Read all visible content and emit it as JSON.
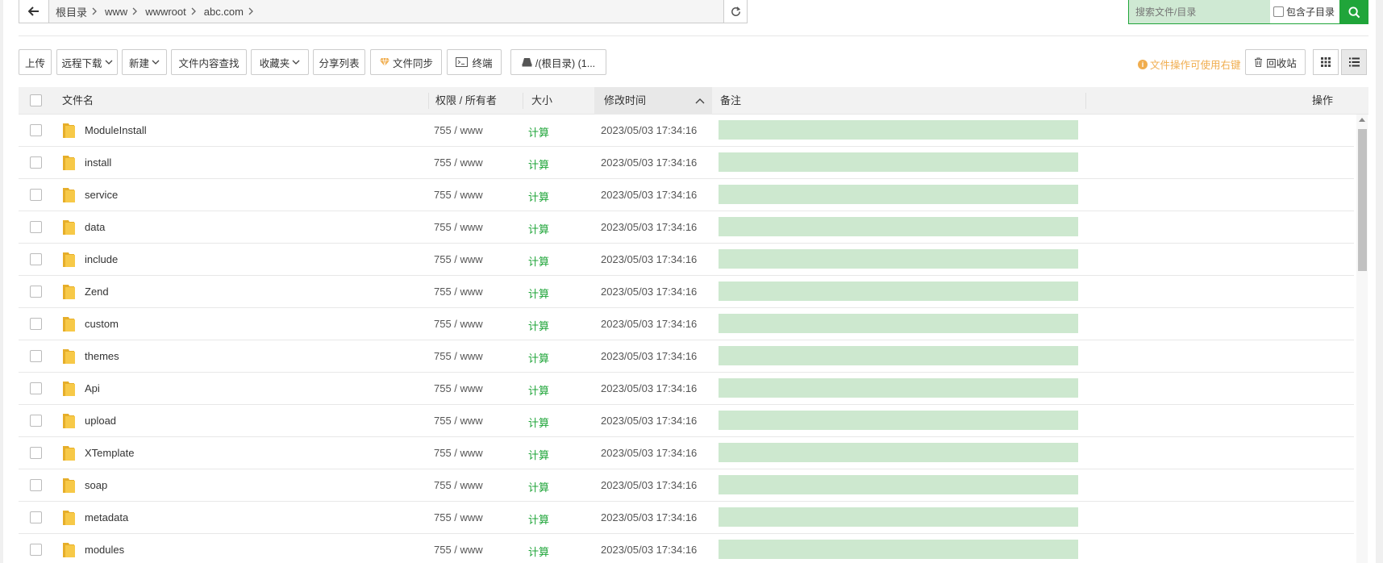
{
  "breadcrumb": [
    "根目录",
    "www",
    "wwwroot",
    "abc.com"
  ],
  "search": {
    "placeholder": "搜索文件/目录",
    "include_sub_label": "包含子目录"
  },
  "toolbar": {
    "upload": "上传",
    "remote_download": "远程下载",
    "new": "新建",
    "content_search": "文件内容查找",
    "favorites": "收藏夹",
    "share_list": "分享列表",
    "file_sync": "文件同步",
    "terminal": "终端",
    "disk": "/(根目录) (1...",
    "tip": "文件操作可使用右键",
    "recycle": "回收站"
  },
  "table": {
    "headers": {
      "name": "文件名",
      "perm": "权限 / 所有者",
      "size": "大小",
      "mtime": "修改时间",
      "note": "备注",
      "ops": "操作"
    },
    "rows": [
      {
        "name": "ModuleInstall",
        "perm": "755 / www",
        "size": "计算",
        "mtime": "2023/05/03 17:34:16"
      },
      {
        "name": "install",
        "perm": "755 / www",
        "size": "计算",
        "mtime": "2023/05/03 17:34:16"
      },
      {
        "name": "service",
        "perm": "755 / www",
        "size": "计算",
        "mtime": "2023/05/03 17:34:16"
      },
      {
        "name": "data",
        "perm": "755 / www",
        "size": "计算",
        "mtime": "2023/05/03 17:34:16"
      },
      {
        "name": "include",
        "perm": "755 / www",
        "size": "计算",
        "mtime": "2023/05/03 17:34:16"
      },
      {
        "name": "Zend",
        "perm": "755 / www",
        "size": "计算",
        "mtime": "2023/05/03 17:34:16"
      },
      {
        "name": "custom",
        "perm": "755 / www",
        "size": "计算",
        "mtime": "2023/05/03 17:34:16"
      },
      {
        "name": "themes",
        "perm": "755 / www",
        "size": "计算",
        "mtime": "2023/05/03 17:34:16"
      },
      {
        "name": "Api",
        "perm": "755 / www",
        "size": "计算",
        "mtime": "2023/05/03 17:34:16"
      },
      {
        "name": "upload",
        "perm": "755 / www",
        "size": "计算",
        "mtime": "2023/05/03 17:34:16"
      },
      {
        "name": "XTemplate",
        "perm": "755 / www",
        "size": "计算",
        "mtime": "2023/05/03 17:34:16"
      },
      {
        "name": "soap",
        "perm": "755 / www",
        "size": "计算",
        "mtime": "2023/05/03 17:34:16"
      },
      {
        "name": "metadata",
        "perm": "755 / www",
        "size": "计算",
        "mtime": "2023/05/03 17:34:16"
      },
      {
        "name": "modules",
        "perm": "755 / www",
        "size": "计算",
        "mtime": "2023/05/03 17:34:16"
      }
    ]
  },
  "colors": {
    "accent": "#20a53a",
    "warning": "#f0ad4e",
    "note_bg": "#cde8cf",
    "folder": "#f5c43d"
  }
}
